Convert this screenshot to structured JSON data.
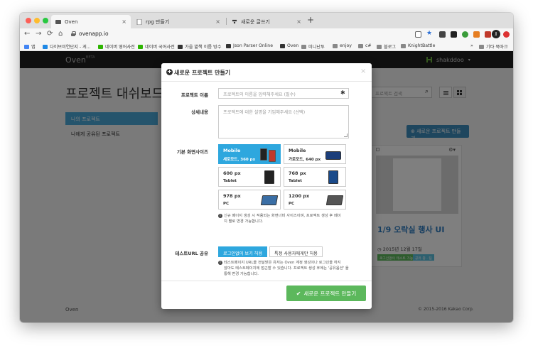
{
  "browser": {
    "tabs": [
      {
        "label": "Oven",
        "active": true
      },
      {
        "label": "rpg 만들기",
        "active": false
      },
      {
        "label": "새로운 글쓰기",
        "active": false
      }
    ],
    "new_tab": "+",
    "tab_close": "×",
    "address": "ovenapp.io",
    "nav": {
      "back": "←",
      "forward": "→",
      "reload": "⟳",
      "home": "⌂"
    },
    "toolbar_icons": {
      "star": "★"
    },
    "profile_initials": "JJ",
    "bookmarks": [
      {
        "label": "앱",
        "color": "#4285f4"
      },
      {
        "label": "다이브미연단지 - 게...",
        "color": "#1e88e5"
      },
      {
        "label": "네이버 영어사전",
        "color": "#2db400"
      },
      {
        "label": "네이버 국어사전",
        "color": "#2db400"
      },
      {
        "label": "가을 밟책 이름 빙수",
        "color": "#333333"
      },
      {
        "label": "Json Parser Online",
        "color": "#333333"
      },
      {
        "label": "Oven",
        "color": "#333333"
      },
      {
        "label": "미니난투",
        "color": "#888888"
      },
      {
        "label": "enjoy",
        "color": "#888888"
      },
      {
        "label": "c#",
        "color": "#888888"
      },
      {
        "label": "블로그",
        "color": "#888888"
      },
      {
        "label": "KnightBattle",
        "color": "#888888"
      }
    ],
    "bookmarks_more": "»",
    "bookmarks_other": "기타 북마크"
  },
  "site": {
    "brand": "Oven",
    "brand_beta": "BETA",
    "username": "shakddoo",
    "user_caret": "▾",
    "page_title": "프로젝트 대쉬보드",
    "sidebar": {
      "active": "나의 프로젝트",
      "item": "나에게 공유된 프로젝트"
    },
    "search_placeholder": "프로젝트 검색",
    "search_icon": "⌕",
    "new_project_button": "새로운 프로젝트 만들기",
    "card": {
      "title": "1/9 오락실 행사 UI",
      "date": "2015년 12월 17일",
      "tags": [
        "로그인없이 테스트 가능",
        "공유 중 · 팀"
      ]
    },
    "footer_left": "Oven",
    "footer_right": "© 2015-2016 Kakao Corp."
  },
  "modal": {
    "title": "새로운 프로젝트 만들기",
    "close": "×",
    "name_label": "프로젝트 이름",
    "name_placeholder": "프로젝트의 이름을 입력해주세요 (필수)",
    "required_mark": "✱",
    "desc_label": "상세내용",
    "desc_placeholder": "프로젝트에 대한 설명을 기입해주세요 (선택)",
    "size_label": "기본 화면사이즈",
    "sizes": [
      {
        "main": "Mobile",
        "sub": "세로모드, 360 px",
        "active": true
      },
      {
        "main": "Mobile",
        "sub": "가로모드, 640 px",
        "active": false
      },
      {
        "main": "600 px",
        "sub": "Tablet",
        "active": false
      },
      {
        "main": "768 px",
        "sub": "Tablet",
        "active": false
      },
      {
        "main": "978 px",
        "sub": "PC",
        "active": false
      },
      {
        "main": "1200 px",
        "sub": "PC",
        "active": false
      }
    ],
    "size_note_line1": "신규 페이지 생성 시 적용되는 화면너비 사이즈이며, 프로젝트 생성 후 페이",
    "size_note_line2": "지 별로 변경 가능합니다.",
    "share_label": "테스트URL 공유",
    "share_options": [
      {
        "label": "로그인없이 보기 허용",
        "active": true
      },
      {
        "label": "특정 사용자에게만 허용",
        "active": false
      }
    ],
    "share_note_line1": "테스트페이지 URL을 전달받은 유저는 Oven 계정 생성이나 로그인을 하지",
    "share_note_line2": "않아도 테스트페이지에 접근할 수 있습니다. 프로젝트 생성 후에는 '공유옵션' 을",
    "share_note_line3": "통해 변경 가능합니다.",
    "create_button": "새로운 프로젝트 만들기"
  },
  "colors": {
    "accent_blue": "#2ea7de",
    "create_green": "#5cb85c",
    "header_dark": "#1f1f1f"
  }
}
